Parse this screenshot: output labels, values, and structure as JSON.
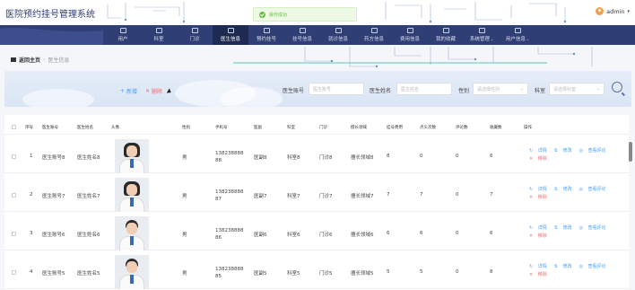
{
  "app": {
    "title": "医院预约挂号管理系统"
  },
  "toast": {
    "message": "操作成功"
  },
  "user": {
    "name": "admin",
    "caret": "▾"
  },
  "nav": {
    "items": [
      {
        "label": "用户",
        "active": false
      },
      {
        "label": "科室",
        "active": false
      },
      {
        "label": "门诊",
        "active": false
      },
      {
        "label": "医生信息",
        "active": true
      },
      {
        "label": "预约挂号",
        "active": false
      },
      {
        "label": "挂号信息",
        "active": false
      },
      {
        "label": "就诊信息",
        "active": false
      },
      {
        "label": "药方信息",
        "active": false
      },
      {
        "label": "费用信息",
        "active": false
      },
      {
        "label": "我的收藏",
        "active": false
      },
      {
        "label": "系统管理",
        "active": false,
        "dropdown": true
      },
      {
        "label": "用户信息",
        "active": false,
        "dropdown": true
      }
    ]
  },
  "breadcrumb": {
    "home": "返回主页",
    "sep": "›",
    "current": "医生信息"
  },
  "toolbar": {
    "add": "新增",
    "delete": "删除"
  },
  "filters": {
    "account_label": "医生账号",
    "account_placeholder": "医生账号",
    "name_label": "医生姓名",
    "name_placeholder": "医生姓名",
    "gender_label": "性别",
    "gender_placeholder": "请选择性别",
    "dept_label": "科室",
    "dept_placeholder": "请选择科室",
    "select_arrow": "⌄"
  },
  "table": {
    "headers": [
      "序号",
      "医生账号",
      "医生姓名",
      "头像",
      "性别",
      "手机号",
      "医副",
      "科室",
      "门诊",
      "擅长领域",
      "挂号费用",
      "点头次数",
      "评论数",
      "收藏数",
      "操作"
    ],
    "rows": [
      {
        "index": "1",
        "account": "医生账号8",
        "name": "医生姓名8",
        "gender": "男",
        "phone": "13823888888",
        "title": "医副8",
        "dept": "科室8",
        "clinic": "门诊8",
        "field": "擅长领域8",
        "fee": "8",
        "thumbs": "0",
        "comments": "0",
        "favorites": "6",
        "gender_photo": "female"
      },
      {
        "index": "2",
        "account": "医生账号7",
        "name": "医生姓名7",
        "gender": "男",
        "phone": "13823888887",
        "title": "医副7",
        "dept": "科室7",
        "clinic": "门诊7",
        "field": "擅长领域7",
        "fee": "7",
        "thumbs": "7",
        "comments": "0",
        "favorites": "7",
        "gender_photo": "female"
      },
      {
        "index": "3",
        "account": "医生账号6",
        "name": "医生姓名6",
        "gender": "男",
        "phone": "13823888886",
        "title": "医副6",
        "dept": "科室6",
        "clinic": "门诊6",
        "field": "擅长领域6",
        "fee": "6",
        "thumbs": "6",
        "comments": "0",
        "favorites": "6",
        "gender_photo": "male"
      },
      {
        "index": "4",
        "account": "医生账号5",
        "name": "医生姓名5",
        "gender": "男",
        "phone": "13823888885",
        "title": "医副5",
        "dept": "科室5",
        "clinic": "门诊5",
        "field": "擅长领域5",
        "fee": "5",
        "thumbs": "5",
        "comments": "0",
        "favorites": "8",
        "gender_photo": "male"
      }
    ],
    "actions": {
      "detail": "详情",
      "edit": "修改",
      "comments": "查看评论",
      "remove": "移除"
    }
  },
  "colors": {
    "nav": "#2f3e74",
    "nav_active": "#1e2a52",
    "primary": "#409eff",
    "danger": "#f56c6c",
    "success": "#67c23a"
  }
}
